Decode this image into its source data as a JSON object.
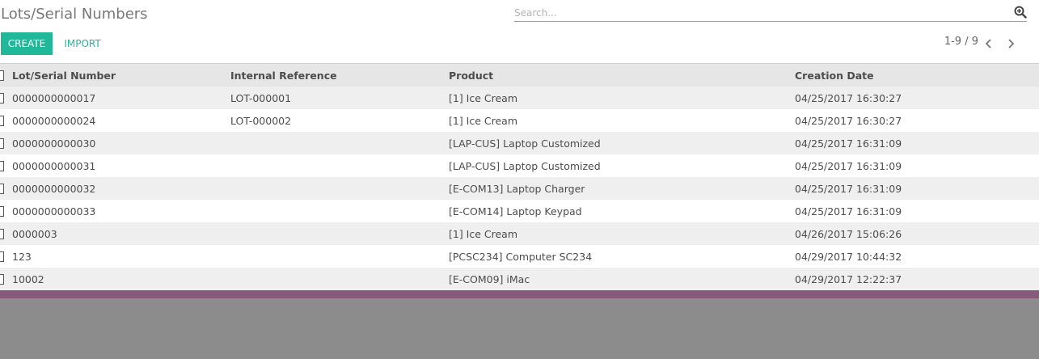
{
  "header": {
    "title": "Lots/Serial Numbers",
    "search_placeholder": "Search..."
  },
  "toolbar": {
    "create_label": "CREATE",
    "import_label": "IMPORT"
  },
  "pager": {
    "text": "1-9 / 9"
  },
  "table": {
    "columns": [
      "Lot/Serial Number",
      "Internal Reference",
      "Product",
      "Creation Date"
    ],
    "rows": [
      {
        "lot": "0000000000017",
        "ref": "LOT-000001",
        "product": "[1] Ice Cream",
        "date": "04/25/2017 16:30:27"
      },
      {
        "lot": "0000000000024",
        "ref": "LOT-000002",
        "product": "[1] Ice Cream",
        "date": "04/25/2017 16:30:27"
      },
      {
        "lot": "0000000000030",
        "ref": "",
        "product": "[LAP-CUS] Laptop Customized",
        "date": "04/25/2017 16:31:09"
      },
      {
        "lot": "0000000000031",
        "ref": "",
        "product": "[LAP-CUS] Laptop Customized",
        "date": "04/25/2017 16:31:09"
      },
      {
        "lot": "0000000000032",
        "ref": "",
        "product": "[E-COM13] Laptop Charger",
        "date": "04/25/2017 16:31:09"
      },
      {
        "lot": "0000000000033",
        "ref": "",
        "product": "[E-COM14] Laptop Keypad",
        "date": "04/25/2017 16:31:09"
      },
      {
        "lot": "0000003",
        "ref": "",
        "product": "[1] Ice Cream",
        "date": "04/26/2017 15:06:26"
      },
      {
        "lot": "123",
        "ref": "",
        "product": "[PCSC234] Computer SC234",
        "date": "04/29/2017 10:44:32"
      },
      {
        "lot": "10002",
        "ref": "",
        "product": "[E-COM09] iMac",
        "date": "04/29/2017 12:22:37"
      }
    ]
  },
  "colors": {
    "accent": "#21b799",
    "brand_bar": "#875a7b",
    "backdrop": "#8c8c8c"
  },
  "icons": {
    "search": "search-plus-icon",
    "prev": "chevron-left-icon",
    "next": "chevron-right-icon"
  }
}
